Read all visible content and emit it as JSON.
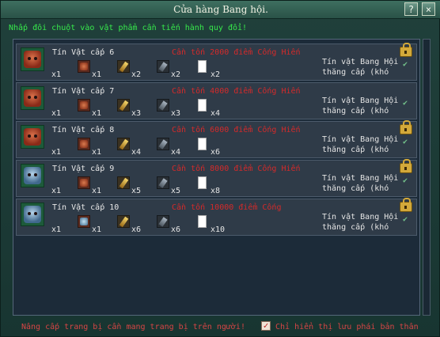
{
  "window": {
    "title": "Cửa hàng Bang hội."
  },
  "title_buttons": {
    "help_icon": "?",
    "close_icon": "×"
  },
  "instruction": "Nhấp đôi chuột vào vật phẩm cần tiến hành quy đổi!",
  "rows": [
    {
      "level": "Tín Vật cấp 6",
      "cost": "Cần tốn 2000 điểm Cống Hiến",
      "token_color": "red",
      "token_qty": "x1",
      "mats": {
        "mini": "x1",
        "gold": "x2",
        "ore": "x2",
        "paper": "x2"
      },
      "desc": [
        "Tín vật Bang Hội",
        "thăng cấp (khó"
      ]
    },
    {
      "level": "Tín Vật cấp 7",
      "cost": "Cần tốn 4000 điểm Cống Hiến",
      "token_color": "red",
      "token_qty": "x1",
      "mats": {
        "mini": "x1",
        "gold": "x3",
        "ore": "x3",
        "paper": "x4"
      },
      "desc": [
        "Tín vật Bang Hội",
        "thăng cấp (khó"
      ]
    },
    {
      "level": "Tín Vật cấp 8",
      "cost": "Cần tốn 6000 điểm Cống Hiến",
      "token_color": "red",
      "token_qty": "x1",
      "mats": {
        "mini": "x1",
        "gold": "x4",
        "ore": "x4",
        "paper": "x6"
      },
      "desc": [
        "Tín vật Bang Hội",
        "thăng cấp (khó"
      ]
    },
    {
      "level": "Tín Vật cấp 9",
      "cost": "Cần tốn 8000 điểm Cống Hiến",
      "token_color": "blue",
      "token_qty": "x1",
      "mats": {
        "mini": "x1",
        "gold": "x5",
        "ore": "x5",
        "paper": "x8"
      },
      "desc": [
        "Tín vật Bang Hội",
        "thăng cấp (khó"
      ]
    },
    {
      "level": "Tín Vật cấp 10",
      "cost": "Cần tốn 10000 điểm Cống",
      "token_color": "blue",
      "token_qty": "x1",
      "mats": {
        "mini": "x1",
        "gold": "x6",
        "ore": "x6",
        "paper": "x10"
      },
      "desc": [
        "Tín vật Bang Hội",
        "thăng cấp (khó"
      ]
    }
  ],
  "footer": {
    "note": "Nâng cấp trang bị cần mang trang bị trên người!",
    "checkbox_checked": true,
    "checkbox_mark": "✓",
    "checkbox_label": "Chỉ hiển thị lưu phái bản thân"
  },
  "colors": {
    "instruction": "#37e84b",
    "cost": "#d42a2a",
    "footer_text": "#d64545"
  }
}
